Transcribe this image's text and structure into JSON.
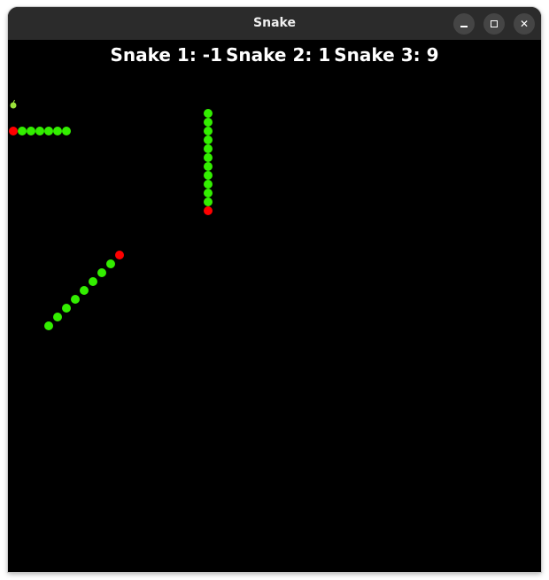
{
  "window": {
    "title": "Snake",
    "buttons": {
      "minimize_icon": "minimize-icon",
      "maximize_icon": "maximize-icon",
      "close_icon": "close-icon",
      "close_glyph": "✕"
    }
  },
  "scores": [
    {
      "label": "Snake 1: -1"
    },
    {
      "label": "Snake 2: 1"
    },
    {
      "label": "Snake 3: 9"
    }
  ],
  "colors": {
    "background": "#000000",
    "snake_body": "#33ee00",
    "snake_head": "#ff0000",
    "apple": "#9be33a",
    "text": "#ffffff"
  },
  "grid": {
    "cell_size_units": 1,
    "columns": 60,
    "rows": 60
  },
  "snakes": [
    {
      "id": 1,
      "head": [
        0,
        8
      ],
      "body": [
        [
          1,
          8
        ],
        [
          2,
          8
        ],
        [
          3,
          8
        ],
        [
          4,
          8
        ],
        [
          5,
          8
        ],
        [
          6,
          8
        ]
      ]
    },
    {
      "id": 2,
      "head": [
        22,
        17
      ],
      "body": [
        [
          22,
          16
        ],
        [
          22,
          15
        ],
        [
          22,
          14
        ],
        [
          22,
          13
        ],
        [
          22,
          12
        ],
        [
          22,
          11
        ],
        [
          22,
          10
        ],
        [
          22,
          9
        ],
        [
          22,
          8
        ],
        [
          22,
          7
        ],
        [
          22,
          6
        ]
      ]
    },
    {
      "id": 3,
      "head": [
        12,
        22
      ],
      "body": [
        [
          11,
          23
        ],
        [
          10,
          24
        ],
        [
          9,
          25
        ],
        [
          8,
          26
        ],
        [
          7,
          27
        ],
        [
          6,
          28
        ],
        [
          5,
          29
        ],
        [
          4,
          30
        ]
      ]
    }
  ],
  "apples": [
    [
      0,
      5
    ]
  ]
}
